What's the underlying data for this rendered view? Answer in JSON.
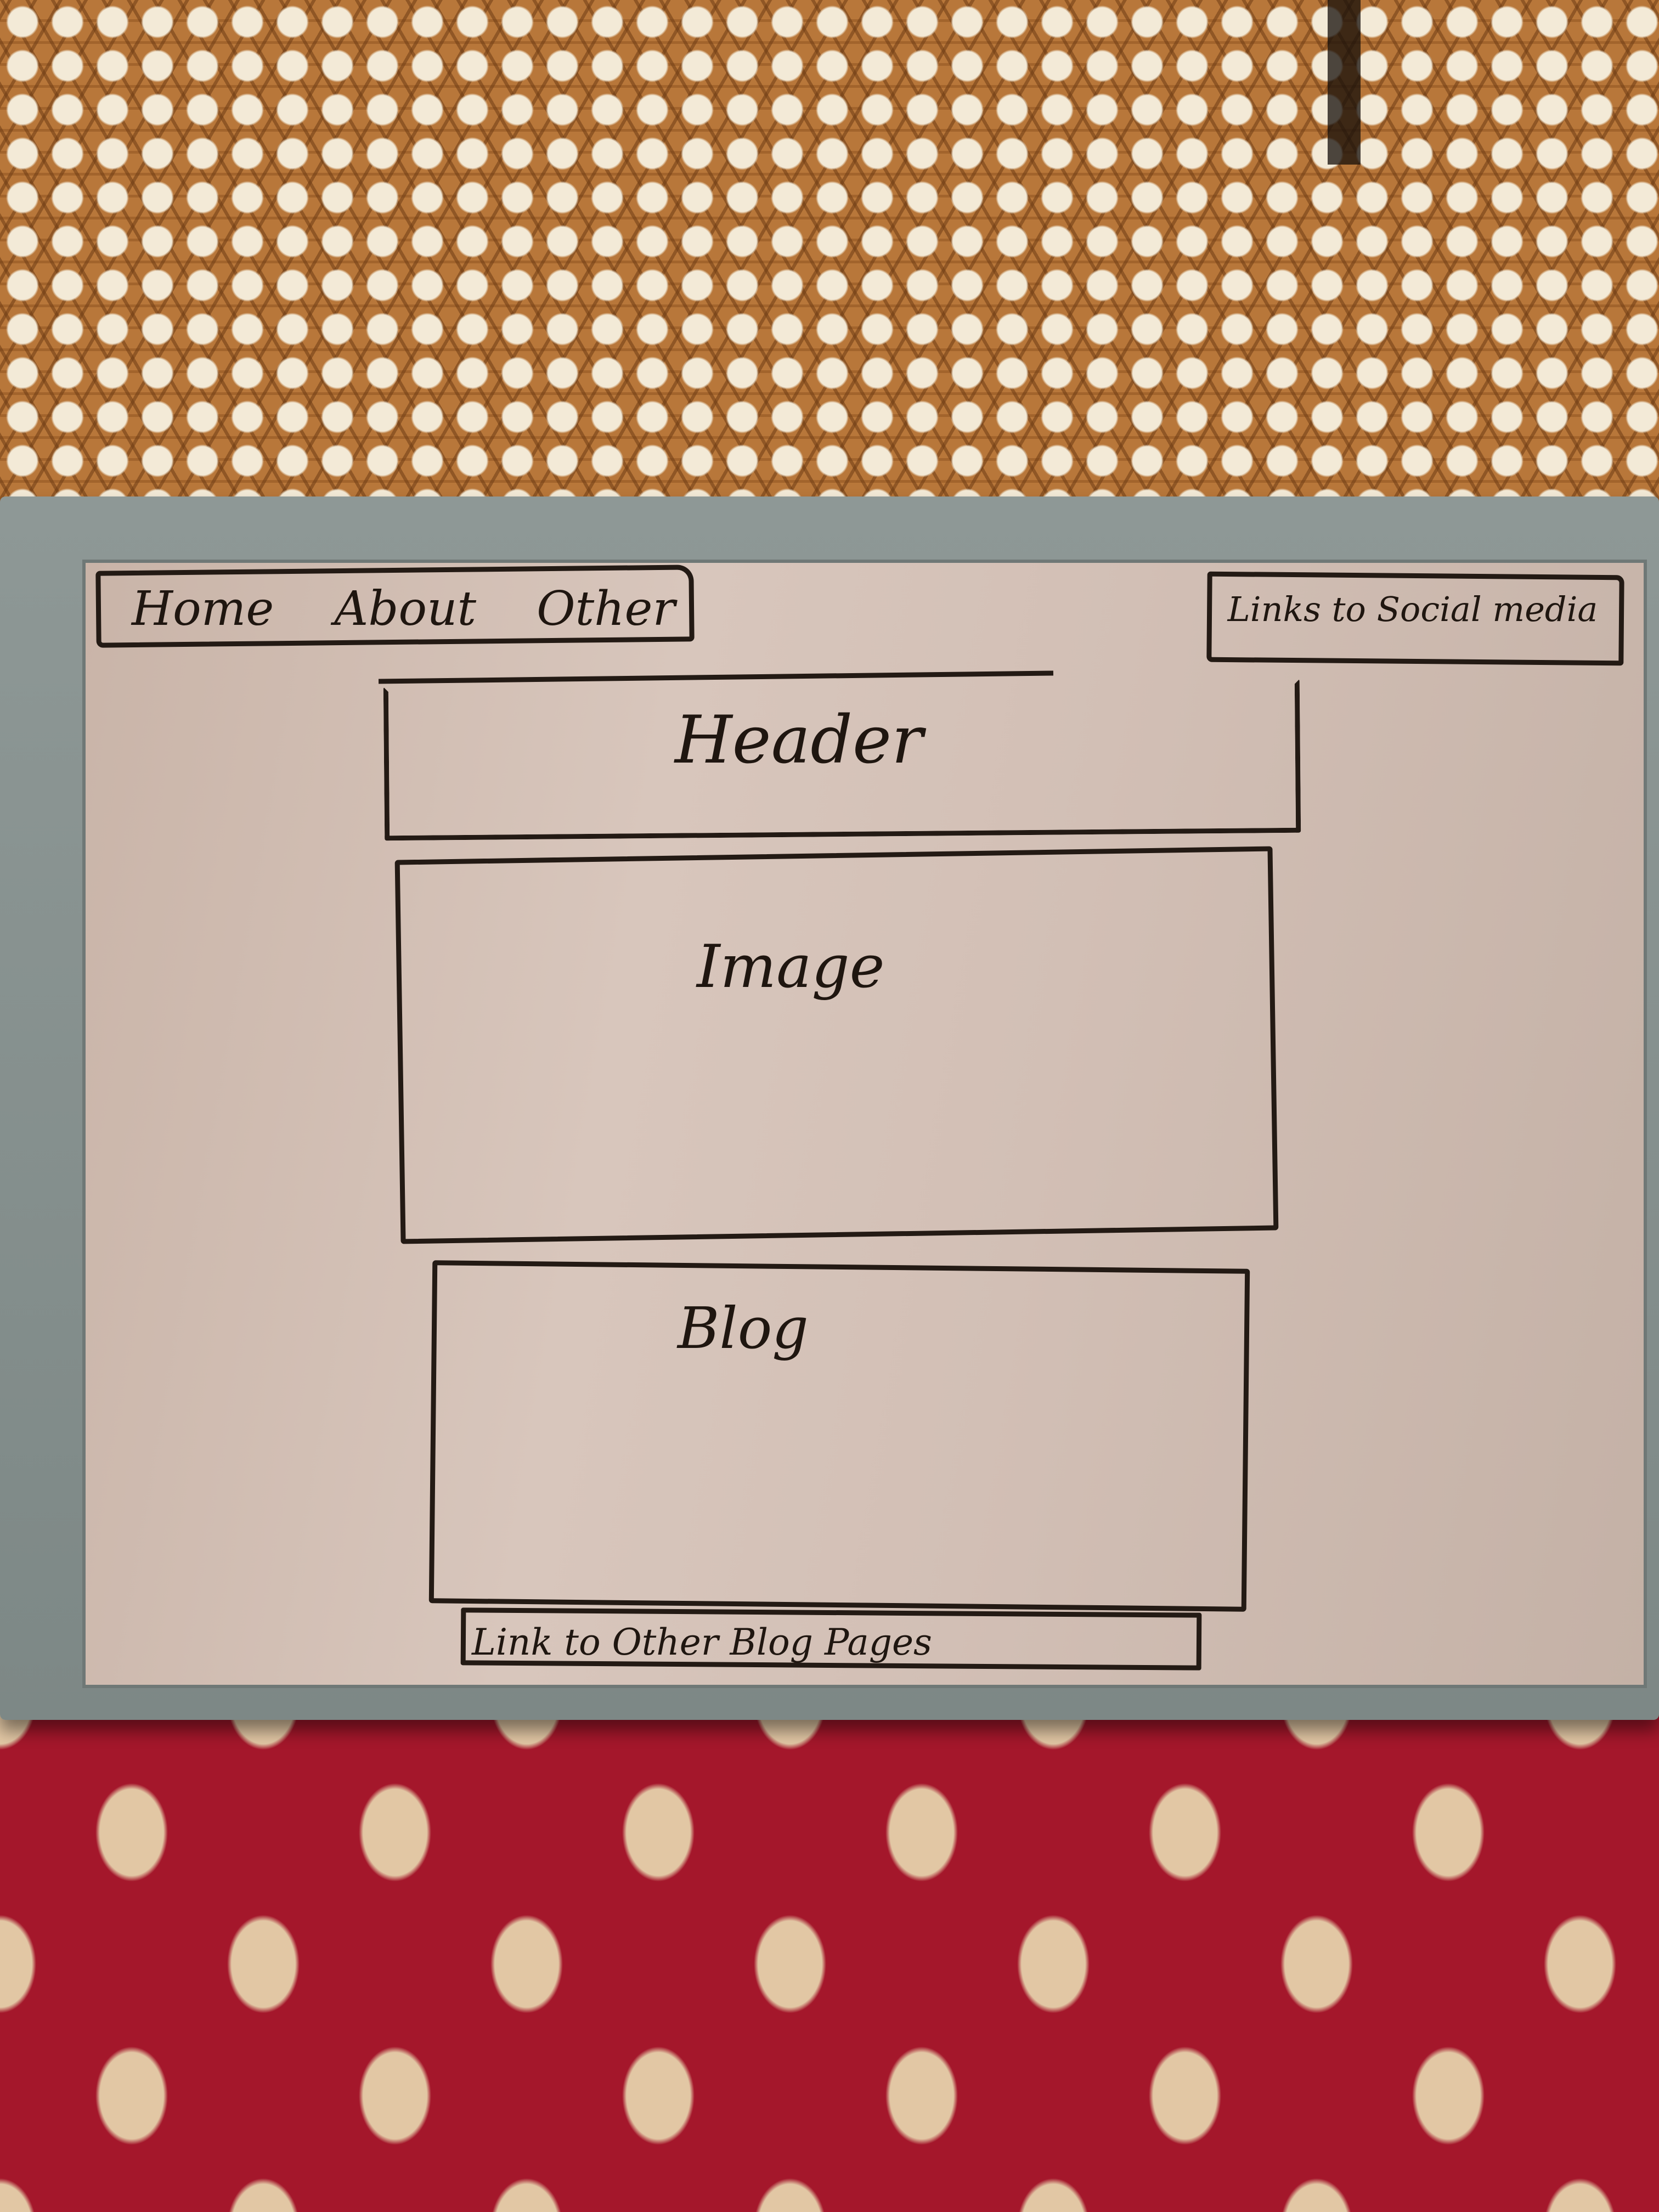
{
  "whiteboard": {
    "nav": [
      "Home",
      "About",
      "Other"
    ],
    "social_links": "Links to Social media",
    "header": "Header",
    "image": "Image",
    "blog": "Blog",
    "blog_pages": "Link to Other Blog Pages"
  },
  "colors": {
    "marker": "#231a14",
    "board": "#d2bfb5",
    "frame": "#8e9896",
    "seat": "#a4172b"
  }
}
